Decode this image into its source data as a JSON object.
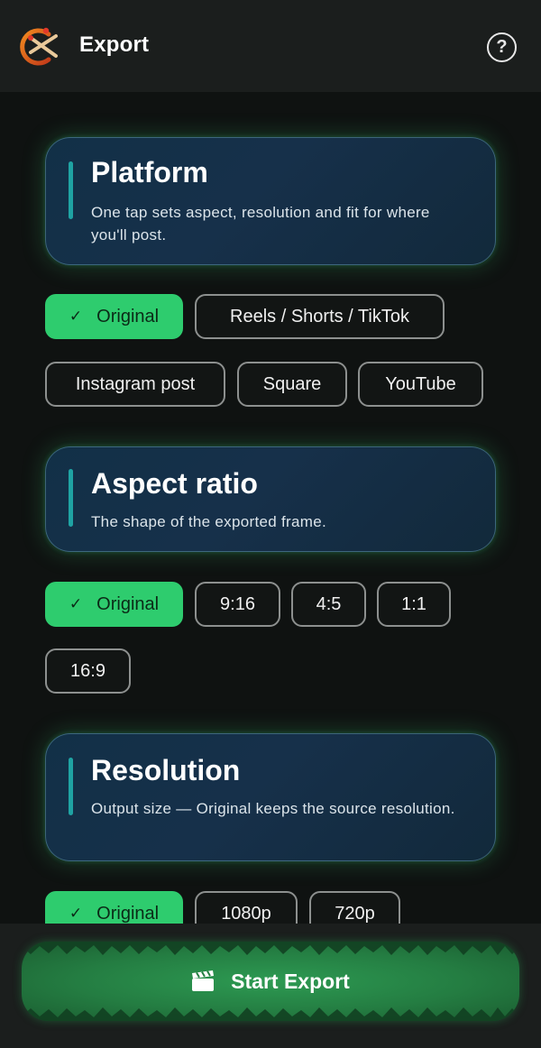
{
  "header": {
    "title": "Export",
    "logo_icon": "app-logo-icon",
    "help_icon": "help-circle-icon",
    "help_glyph": "?"
  },
  "sections": {
    "platform": {
      "title": "Platform",
      "description": "One tap sets aspect, resolution and fit for where you'll post.",
      "options": [
        "Original",
        "Reels / Shorts / TikTok",
        "Instagram post",
        "Square",
        "YouTube"
      ],
      "selected": "Original"
    },
    "aspect": {
      "title": "Aspect ratio",
      "description": "The shape of the exported frame.",
      "options": [
        "Original",
        "9:16",
        "4:5",
        "1:1",
        "16:9"
      ],
      "selected": "Original"
    },
    "resolution": {
      "title": "Resolution",
      "description": "Output size — Original keeps the source resolution.",
      "options": [
        "Original",
        "1080p",
        "720p"
      ],
      "selected": "Original"
    }
  },
  "footer": {
    "start_label": "Start Export",
    "start_icon": "clapperboard-icon"
  },
  "colors": {
    "accent_green": "#2ecc6e",
    "card_bar": "#1fa3a3",
    "background": "#0f1211",
    "bar_background": "#1b1e1d"
  }
}
